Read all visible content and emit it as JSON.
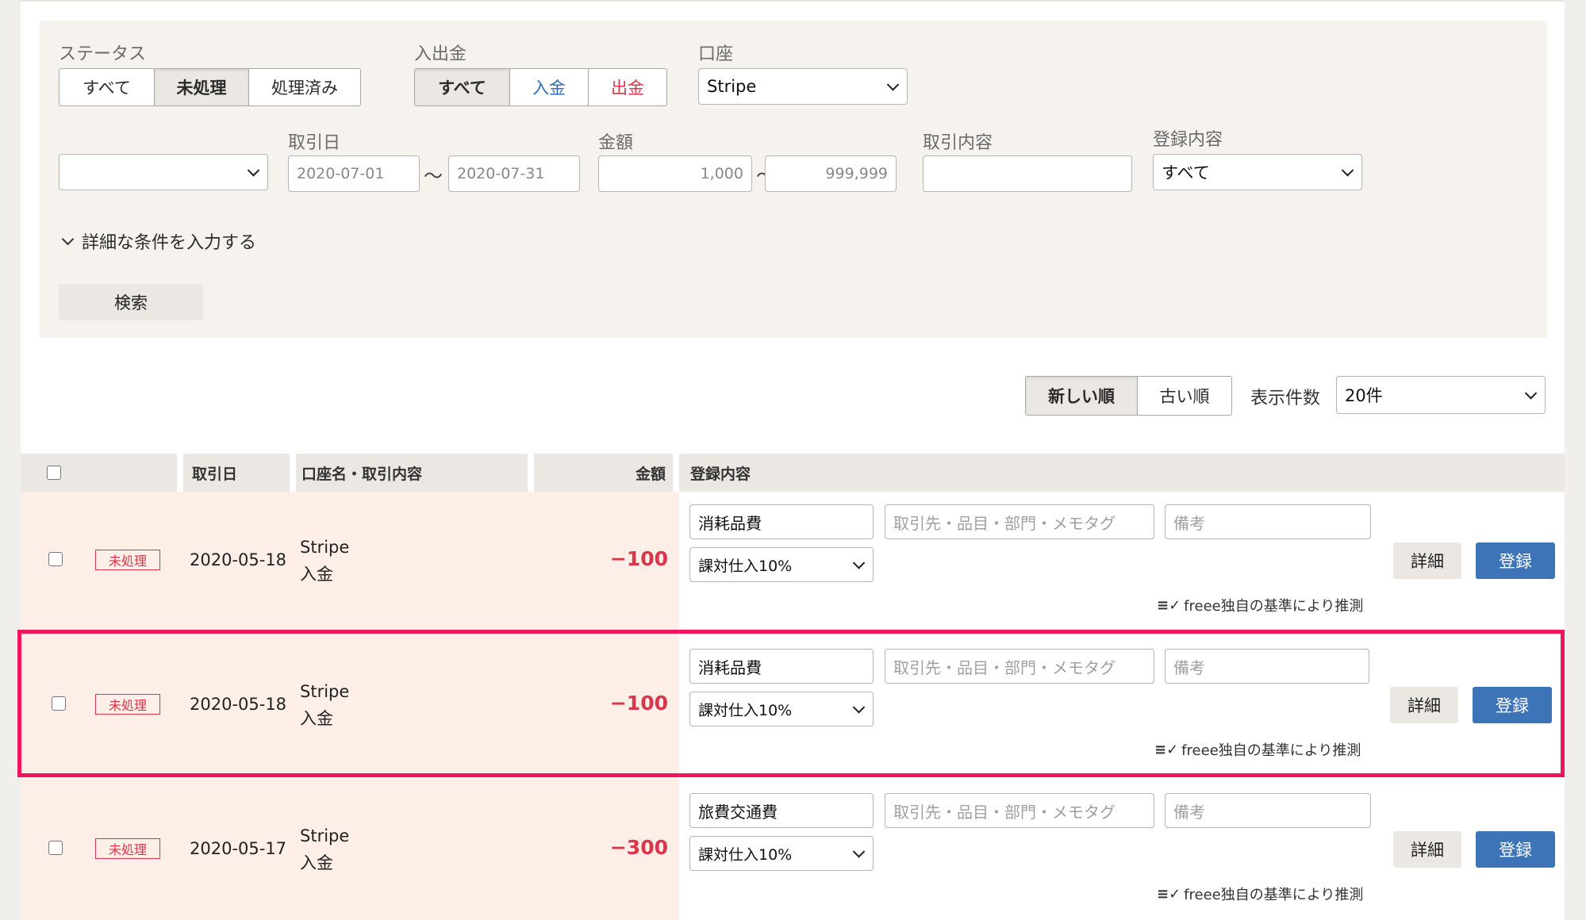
{
  "filters": {
    "status": {
      "label": "ステータス",
      "options": [
        "すべて",
        "未処理",
        "処理済み"
      ]
    },
    "inout": {
      "label": "入出金",
      "options": [
        "すべて",
        "入金",
        "出金"
      ]
    },
    "account": {
      "label": "口座",
      "value": "Stripe"
    },
    "date": {
      "label": "取引日",
      "from": "2020-07-01",
      "to": "2020-07-31"
    },
    "amount": {
      "label": "金額",
      "from": "1,000",
      "to": "999,999"
    },
    "description": {
      "label": "取引内容",
      "value": ""
    },
    "registration": {
      "label": "登録内容",
      "value": "すべて"
    },
    "tilde": "〜",
    "detail_toggle": "詳細な条件を入力する",
    "search_button": "検索"
  },
  "sort": {
    "options": [
      "新しい順",
      "古い順"
    ],
    "page_size_label": "表示件数",
    "page_size_value": "20件"
  },
  "table": {
    "headers": {
      "date": "取引日",
      "account": "口座名・取引内容",
      "amount": "金額",
      "registration": "登録内容"
    },
    "rows": [
      {
        "status": "未処理",
        "date": "2020-05-18",
        "account": "Stripe",
        "type": "入金",
        "amount": "−100",
        "category": "消耗品費",
        "tags_placeholder": "取引先・品目・部門・メモタグ",
        "memo_placeholder": "備考",
        "tax": "課対仕入10%",
        "detail": "詳細",
        "register": "登録",
        "hint": "freee独自の基準により推測"
      },
      {
        "status": "未処理",
        "date": "2020-05-18",
        "account": "Stripe",
        "type": "入金",
        "amount": "−100",
        "category": "消耗品費",
        "tags_placeholder": "取引先・品目・部門・メモタグ",
        "memo_placeholder": "備考",
        "tax": "課対仕入10%",
        "detail": "詳細",
        "register": "登録",
        "hint": "freee独自の基準により推測"
      },
      {
        "status": "未処理",
        "date": "2020-05-17",
        "account": "Stripe",
        "type": "入金",
        "amount": "−300",
        "category": "旅費交通費",
        "tags_placeholder": "取引先・品目・部門・メモタグ",
        "memo_placeholder": "備考",
        "tax": "課対仕入10%",
        "detail": "詳細",
        "register": "登録",
        "hint": "freee独自の基準により推測"
      }
    ]
  },
  "colors": {
    "accent_blue": "#3d74b8",
    "alert_red": "#d9364a",
    "highlight": "#f0165e"
  }
}
